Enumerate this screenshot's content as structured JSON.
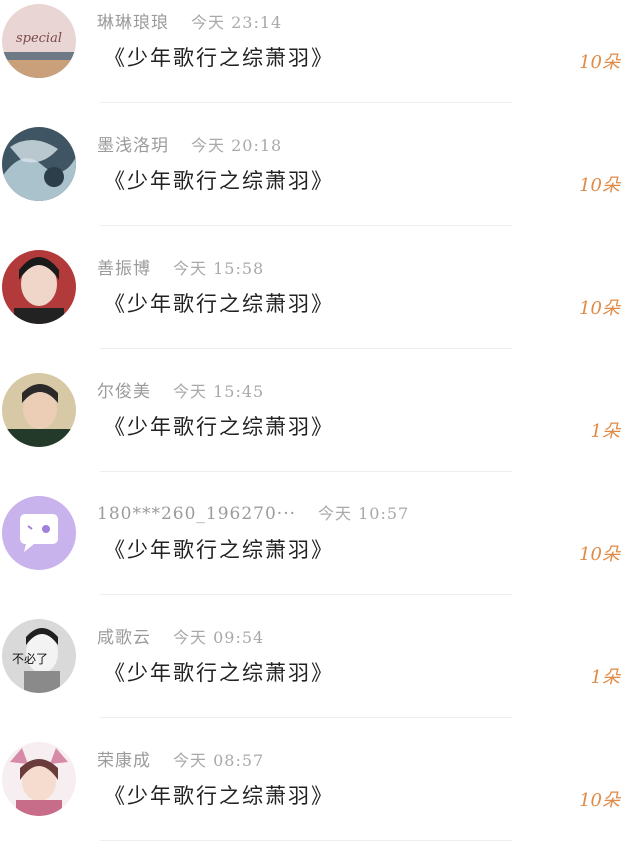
{
  "gifts": [
    {
      "user": "琳琳琅琅",
      "time": "今天 23:14",
      "title": "《少年歌行之综萧羽》",
      "amount": "10朵",
      "avatar_icon": "avatar-special-icon"
    },
    {
      "user": "墨浅洛玥",
      "time": "今天 20:18",
      "title": "《少年歌行之综萧羽》",
      "amount": "10朵",
      "avatar_icon": "avatar-painting-icon"
    },
    {
      "user": "善振博",
      "time": "今天 15:58",
      "title": "《少年歌行之综萧羽》",
      "amount": "10朵",
      "avatar_icon": "avatar-girl-icon"
    },
    {
      "user": "尔俊美",
      "time": "今天 15:45",
      "title": "《少年歌行之综萧羽》",
      "amount": "1朵",
      "avatar_icon": "avatar-boy-icon"
    },
    {
      "user": "180***260_196270···",
      "time": "今天 10:57",
      "title": "《少年歌行之综萧羽》",
      "amount": "10朵",
      "avatar_icon": "avatar-default-chat-icon"
    },
    {
      "user": "咸歌云",
      "time": "今天 09:54",
      "title": "《少年歌行之综萧羽》",
      "amount": "1朵",
      "avatar_icon": "avatar-meme-icon",
      "avatar_text": "不必了"
    },
    {
      "user": "荣康成",
      "time": "今天 08:57",
      "title": "《少年歌行之综萧羽》",
      "amount": "10朵",
      "avatar_icon": "avatar-anime-icon"
    }
  ],
  "colors": {
    "amount": "#e08a45",
    "meta": "#9b9b9b",
    "title": "#222222",
    "divider": "#efefef"
  }
}
